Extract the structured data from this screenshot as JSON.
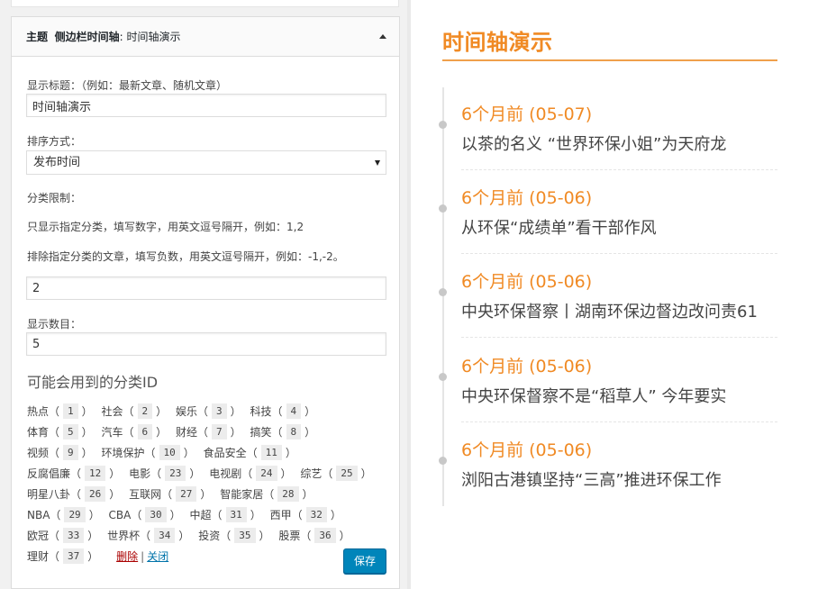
{
  "widget": {
    "title_prefix": "主题",
    "title_name": "侧边栏时间轴",
    "title_suffix": ": 时间轴演示",
    "display_title_label": "显示标题：（例如：最新文章、随机文章）",
    "display_title_value": "时间轴演示",
    "sort_label": "排序方式：",
    "sort_value": "发布时间",
    "category_limit_label": "分类限制：",
    "include_hint": "只显示指定分类，填写数字，用英文逗号隔开，例如：1,2",
    "exclude_hint": "排除指定分类的文章，填写负数，用英文逗号隔开，例如：-1,-2。",
    "category_value": "2",
    "count_label": "显示数目：",
    "count_value": "5",
    "available_cats_heading": "可能会用到的分类ID",
    "categories": [
      {
        "name": "热点",
        "id": "1"
      },
      {
        "name": "社会",
        "id": "2"
      },
      {
        "name": "娱乐",
        "id": "3"
      },
      {
        "name": "科技",
        "id": "4"
      },
      {
        "name": "体育",
        "id": "5"
      },
      {
        "name": "汽车",
        "id": "6"
      },
      {
        "name": "财经",
        "id": "7"
      },
      {
        "name": "搞笑",
        "id": "8"
      },
      {
        "name": "视频",
        "id": "9"
      },
      {
        "name": "环境保护",
        "id": "10"
      },
      {
        "name": "食品安全",
        "id": "11"
      },
      {
        "name": "反腐倡廉",
        "id": "12"
      },
      {
        "name": "电影",
        "id": "23"
      },
      {
        "name": "电视剧",
        "id": "24"
      },
      {
        "name": "综艺",
        "id": "25"
      },
      {
        "name": "明星八卦",
        "id": "26"
      },
      {
        "name": "互联网",
        "id": "27"
      },
      {
        "name": "智能家居",
        "id": "28"
      },
      {
        "name": "NBA",
        "id": "29"
      },
      {
        "name": "CBA",
        "id": "30"
      },
      {
        "name": "中超",
        "id": "31"
      },
      {
        "name": "西甲",
        "id": "32"
      },
      {
        "name": "欧冠",
        "id": "33"
      },
      {
        "name": "世界杯",
        "id": "34"
      },
      {
        "name": "投资",
        "id": "35"
      },
      {
        "name": "股票",
        "id": "36"
      },
      {
        "name": "理财",
        "id": "37"
      }
    ],
    "delete_label": "删除",
    "separator": "|",
    "close_label": "关闭",
    "save_label": "保存"
  },
  "timeline": {
    "title": "时间轴演示",
    "items": [
      {
        "date": "6个月前 (05-07)",
        "text": "以茶的名义 “世界环保小姐”为天府龙"
      },
      {
        "date": "6个月前 (05-06)",
        "text": "从环保“成绩单”看干部作风"
      },
      {
        "date": "6个月前 (05-06)",
        "text": "中央环保督察丨湖南环保边督边改问责61"
      },
      {
        "date": "6个月前 (05-06)",
        "text": "中央环保督察不是“稻草人” 今年要实"
      },
      {
        "date": "6个月前 (05-06)",
        "text": "浏阳古港镇坚持“三高”推进环保工作"
      }
    ]
  },
  "colors": {
    "accent": "#f08a24",
    "primary_button": "#0085ba",
    "delete_link": "#a00000",
    "close_link": "#0073aa"
  }
}
